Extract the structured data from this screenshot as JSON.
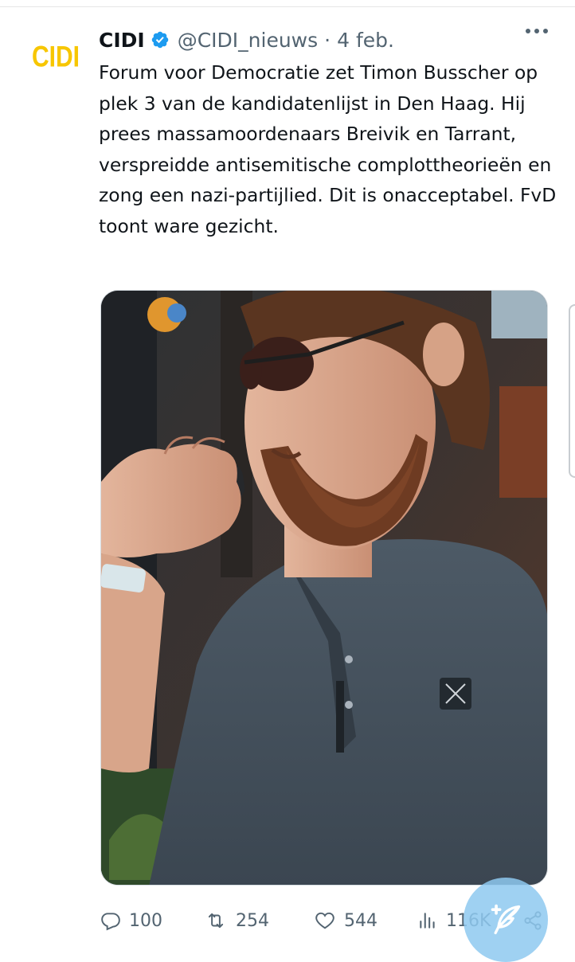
{
  "tweet": {
    "avatar_text": "CIDI",
    "display_name": "CIDI",
    "handle": "@CIDI_nieuws",
    "separator": "·",
    "date": "4 feb.",
    "text": "Forum voor Democratie zet Timon Busscher op plek 3 van de kandidatenlijst in Den Haag. Hij prees massamoordenaars Breivik en Tarrant, verspreidde antisemitische complottheorieën en zong een nazi-partijlied. Dit is onacceptabel. FvD toont ware gezicht."
  },
  "actions": {
    "replies": "100",
    "retweets": "254",
    "likes": "544",
    "views": "116K"
  },
  "colors": {
    "accent": "#1d9bf0",
    "secondary_text": "#536471",
    "brand_yellow": "#f7c600",
    "fab": "#8ec9f0"
  },
  "icons": {
    "verified": "verified-badge-icon",
    "more": "more-options-icon",
    "reply": "reply-icon",
    "retweet": "retweet-icon",
    "like": "heart-icon",
    "views": "views-chart-icon",
    "share": "share-icon",
    "compose": "compose-feather-icon"
  }
}
